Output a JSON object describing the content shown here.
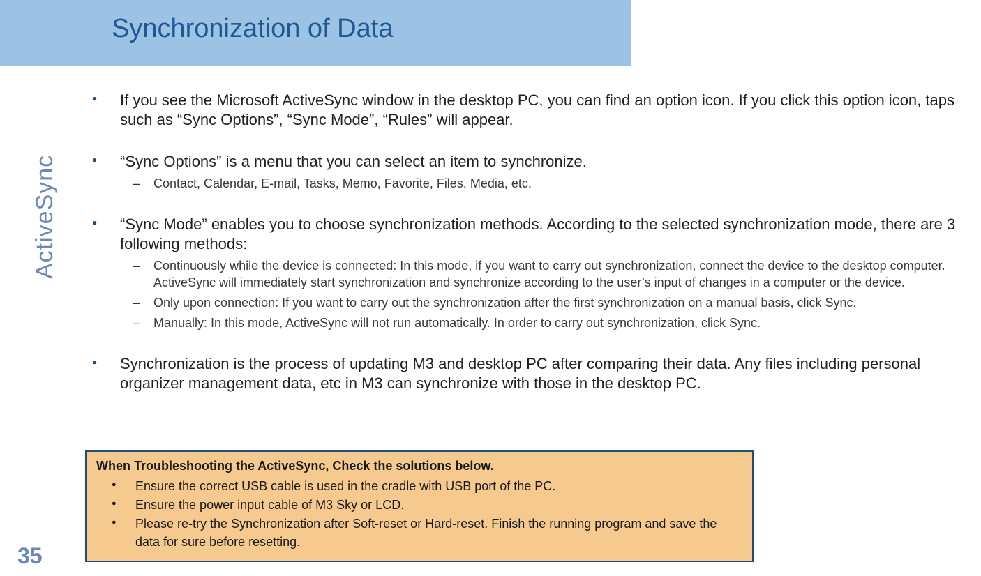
{
  "title": "Synchronization of Data",
  "side_label": "ActiveSync",
  "page_number": "35",
  "bullets": [
    {
      "text": "If you see the Microsoft ActiveSync window in the desktop PC, you can find an option icon. If you click this option icon, taps such as “Sync Options”, “Sync Mode”, “Rules” will appear.",
      "sub": []
    },
    {
      "text": "“Sync Options” is a menu that you can select an item to synchronize.",
      "sub": [
        "Contact, Calendar, E-mail, Tasks, Memo, Favorite, Files, Media, etc."
      ]
    },
    {
      "text": "“Sync Mode” enables you to choose synchronization methods. According to the selected synchronization mode, there are 3 following methods:",
      "sub": [
        "Continuously while the device is connected: In this mode, if you want to carry out synchronization, connect the device to the desktop computer. ActiveSync will immediately start synchronization and synchronize according to the user’s input of changes in a computer or the device.",
        "Only upon connection: If you want to carry out the synchronization after the first synchronization on a manual basis, click Sync.",
        "Manually: In this mode, ActiveSync will not run automatically. In order to carry out synchronization, click Sync."
      ]
    },
    {
      "text": "Synchronization is the process of updating M3 and desktop PC after comparing their data. Any files including personal organizer management data, etc in M3 can synchronize with those in the desktop PC.",
      "sub": []
    }
  ],
  "trouble": {
    "heading": "When Troubleshooting the ActiveSync, Check the solutions below.",
    "items": [
      "Ensure the correct USB cable is used in the cradle with USB port of the PC.",
      "Ensure the power input cable of M3 Sky or LCD.",
      "Please re-try the Synchronization after Soft-reset or Hard-reset. Finish the running program and save the data for sure before resetting."
    ]
  }
}
